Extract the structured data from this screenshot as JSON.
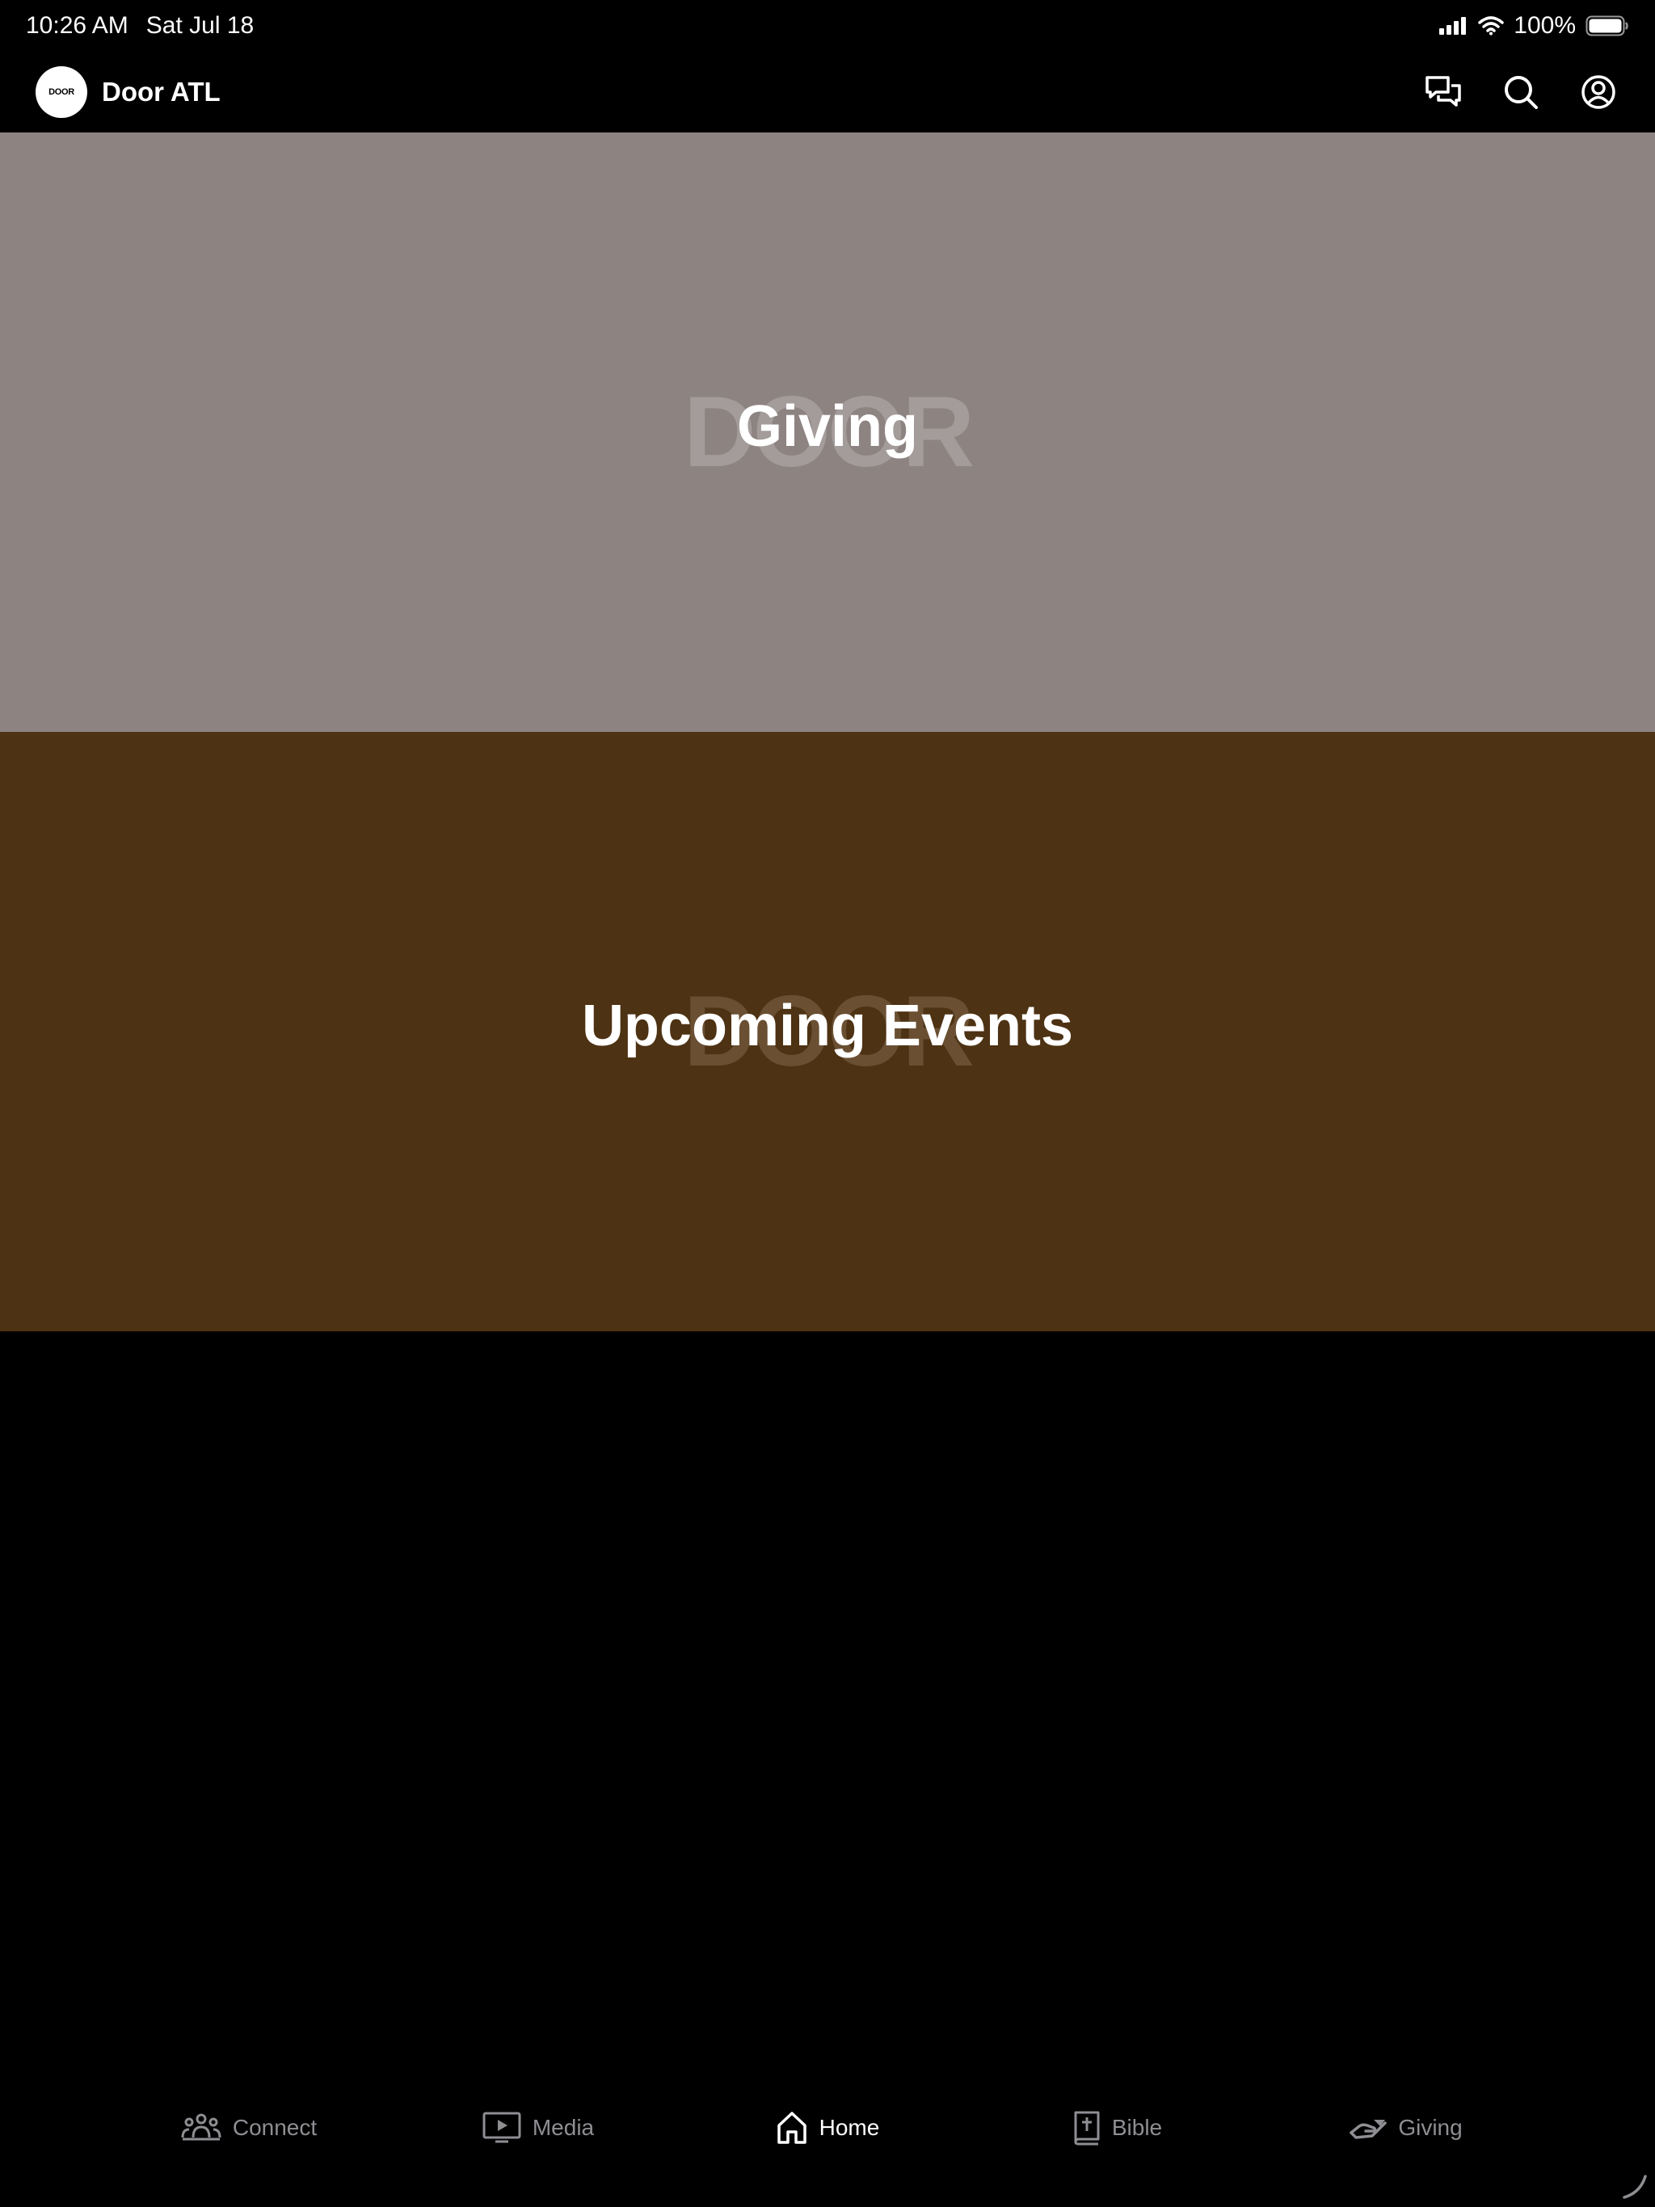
{
  "status_bar": {
    "time": "10:26 AM",
    "date": "Sat Jul 18",
    "battery": "100%"
  },
  "header": {
    "logo_text": "DOOR",
    "title": "Door ATL",
    "icons": [
      "chat-icon",
      "search-icon",
      "profile-icon"
    ]
  },
  "cards": [
    {
      "title": "Giving",
      "watermark": "DOOR",
      "bg": "#8d8482",
      "watermark_color": "#a39c9a"
    },
    {
      "title": "Upcoming Events",
      "watermark": "DOOR",
      "bg": "#4d3213",
      "watermark_color": "#6a4f33"
    }
  ],
  "tabs": [
    {
      "label": "Connect",
      "icon": "people-icon",
      "active": false
    },
    {
      "label": "Media",
      "icon": "tv-play-icon",
      "active": false
    },
    {
      "label": "Home",
      "icon": "home-icon",
      "active": true
    },
    {
      "label": "Bible",
      "icon": "bible-icon",
      "active": false
    },
    {
      "label": "Giving",
      "icon": "giving-hand-icon",
      "active": false
    }
  ],
  "colors": {
    "background": "#000000",
    "tab_inactive": "#8e8e93",
    "tab_active": "#ffffff"
  }
}
